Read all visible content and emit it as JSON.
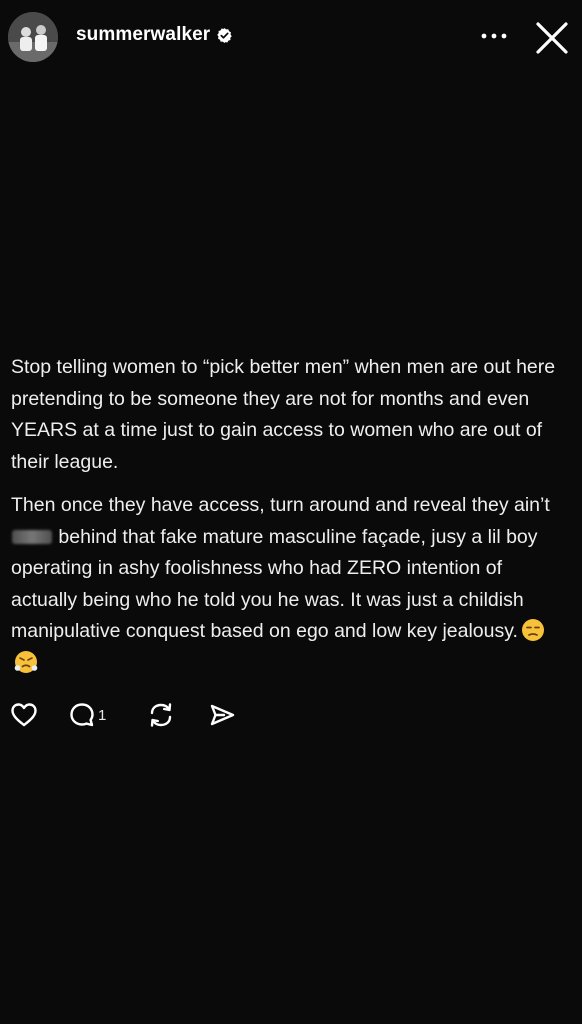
{
  "header": {
    "username": "summerwalker",
    "verified": true
  },
  "post": {
    "paragraph1": "Stop telling women to “pick better men” when men are out here pretending to be someone they are not for months and even YEARS at a time just to gain access to women who are out of their league.",
    "paragraph2_before": "Then once they have access, turn around and reveal they ain’t",
    "paragraph2_censored": "shit",
    "paragraph2_after": "behind that fake mature masculine façade, jusy a lil boy operating in ashy foolishness who had ZERO intention of actually being who he told you he was. It was just a childish manipulative conquest based on ego and low key jealousy.",
    "emojis": [
      "unamused-face",
      "face-with-steam"
    ]
  },
  "actions": {
    "reply_count": "1"
  },
  "colors": {
    "background": "#0a0a0a",
    "text": "#eeeeee",
    "verified_badge": "#ffffff"
  }
}
